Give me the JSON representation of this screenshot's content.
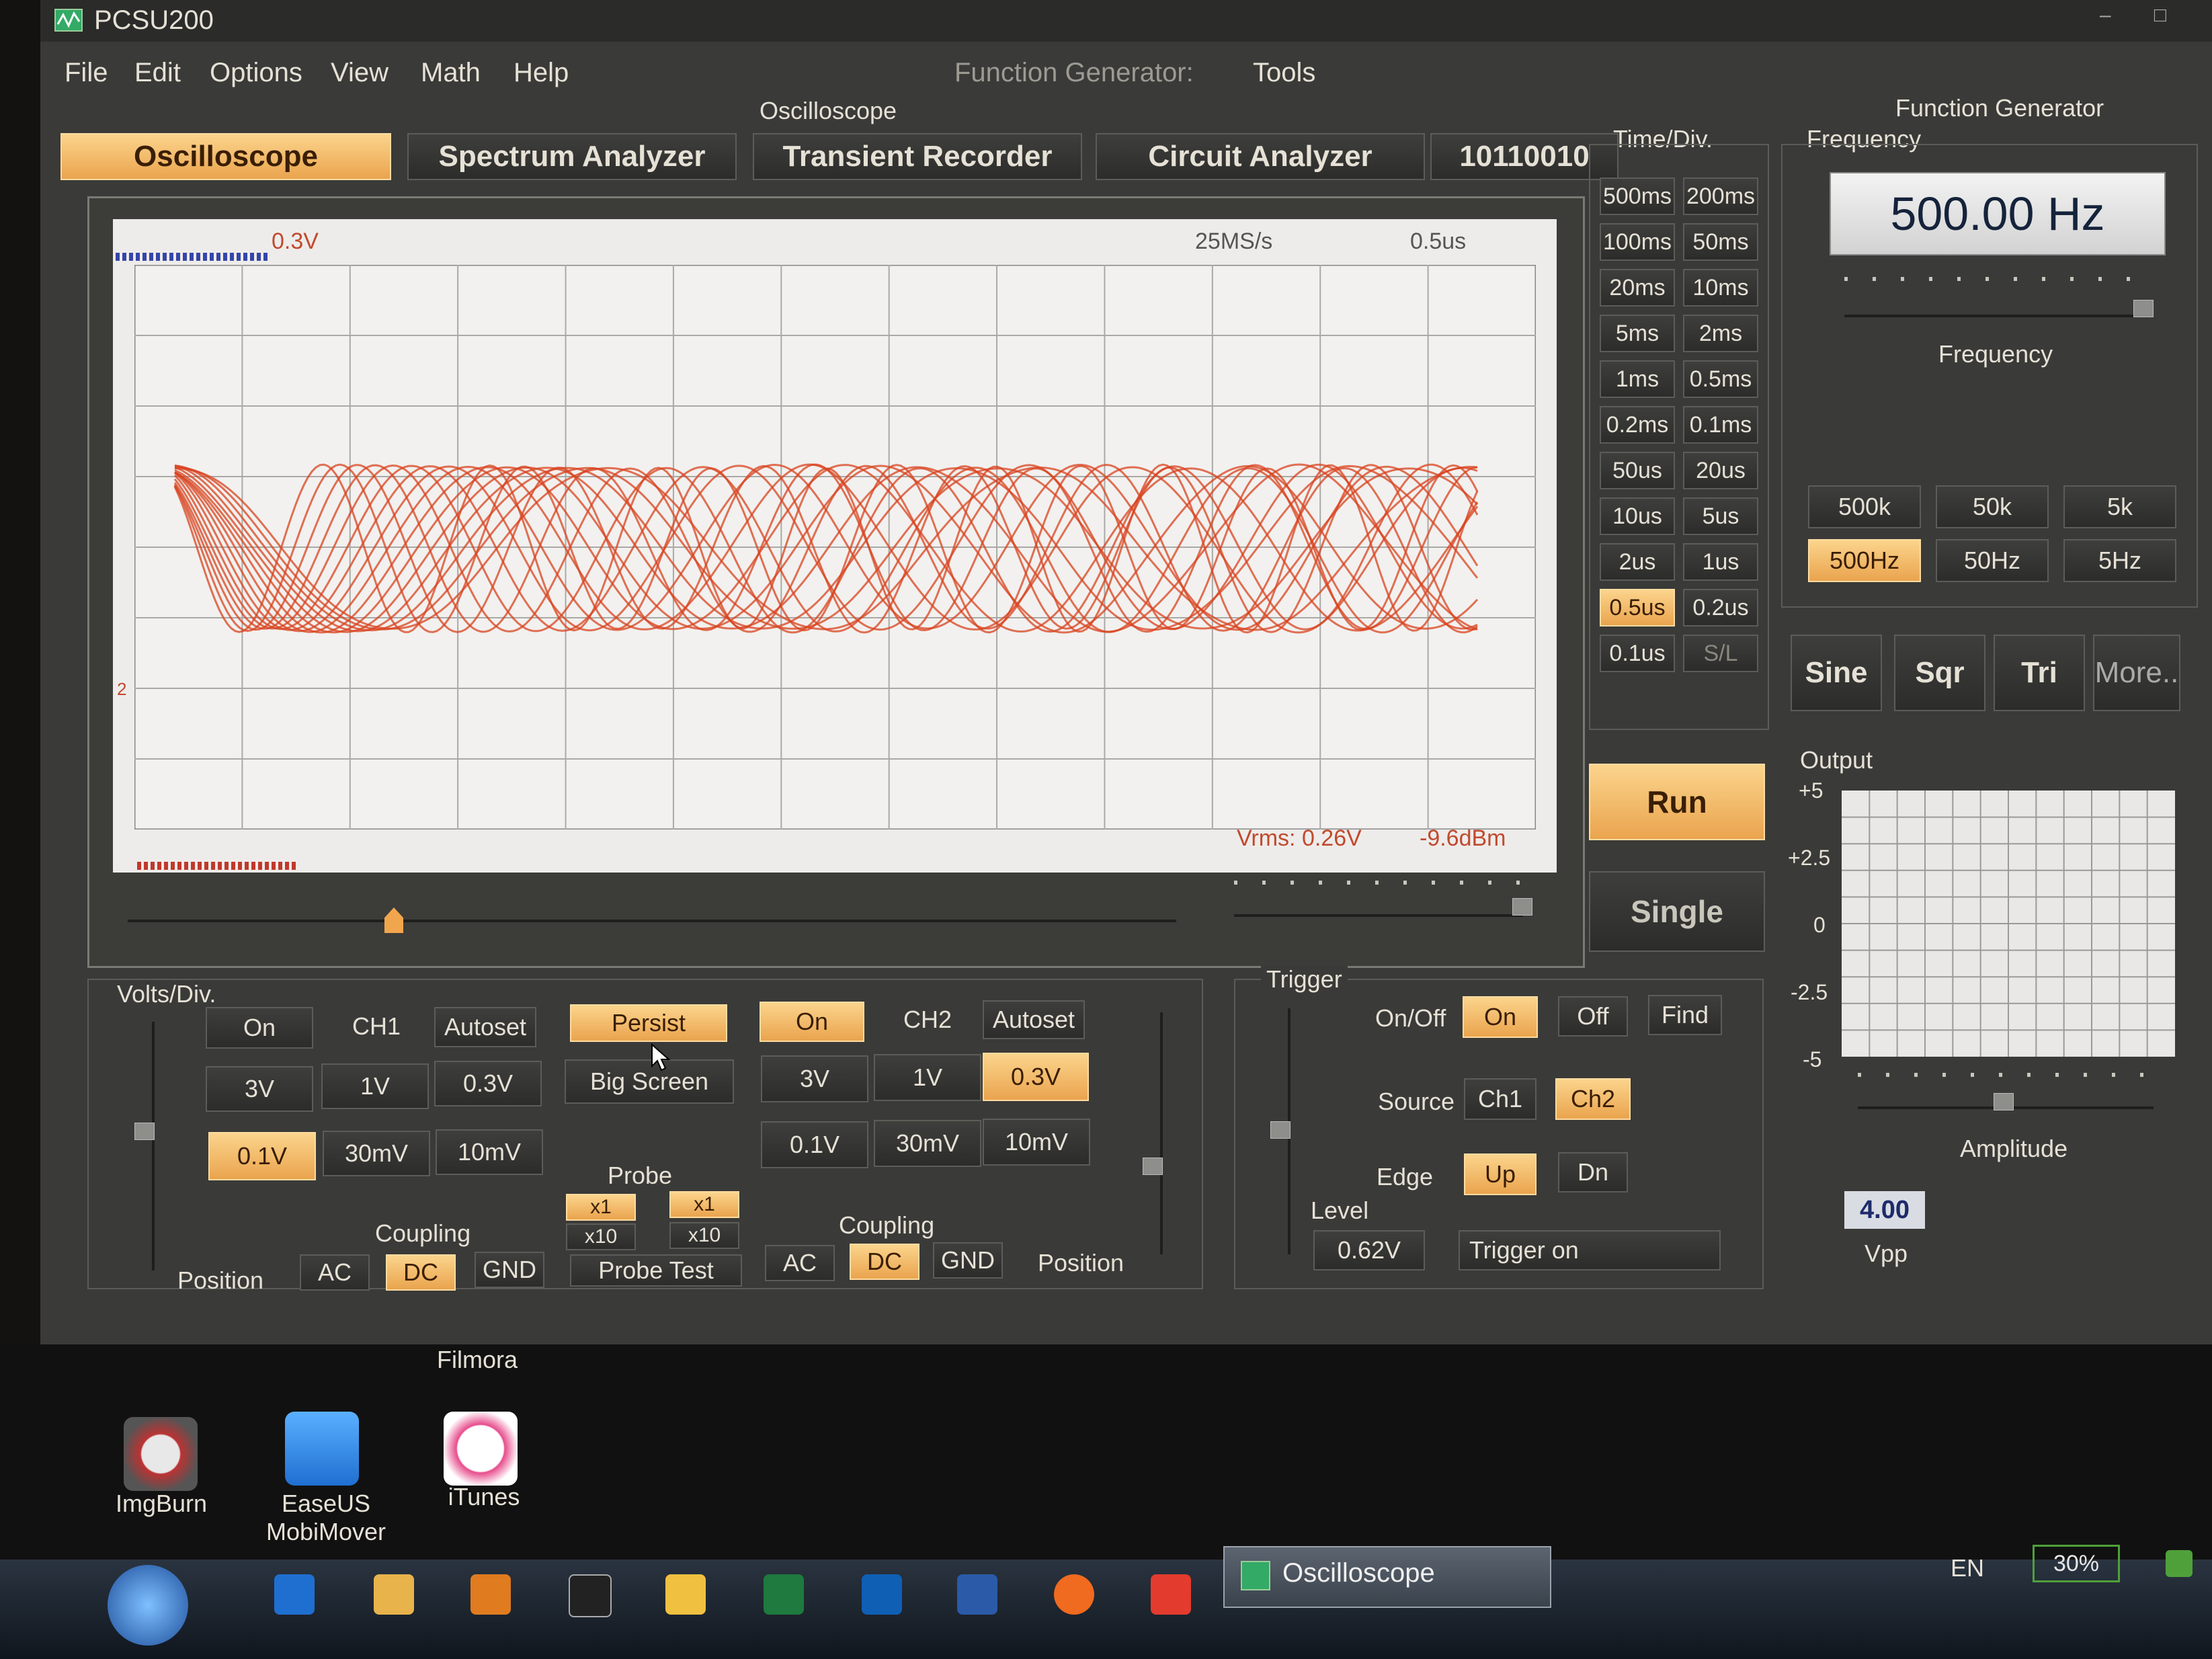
{
  "window": {
    "title": "PCSU200",
    "controls": "– □"
  },
  "menu": {
    "items": [
      "File",
      "Edit",
      "Options",
      "View",
      "Math",
      "Help"
    ],
    "function_generator": "Function Generator:",
    "tools": "Tools"
  },
  "tabs": {
    "group_label": "Oscilloscope",
    "items": [
      "Oscilloscope",
      "Spectrum Analyzer",
      "Transient Recorder",
      "Circuit Analyzer"
    ],
    "active": "Oscilloscope",
    "logic_code": "10110010"
  },
  "screen": {
    "ch_volts": "0.3V",
    "sample_rate": "25MS/s",
    "time_per_div": "0.5us",
    "marker_2": "2",
    "vrms": "Vrms: 0.26V",
    "dbm": "-9.6dBm",
    "trace_color": "#d8431f"
  },
  "timebase": {
    "label": "Time/Div.",
    "buttons": [
      "500ms",
      "200ms",
      "100ms",
      "50ms",
      "20ms",
      "10ms",
      "5ms",
      "2ms",
      "1ms",
      "0.5ms",
      "0.2ms",
      "0.1ms",
      "50us",
      "20us",
      "10us",
      "5us",
      "2us",
      "1us",
      "0.5us",
      "0.2us",
      "0.1us",
      "S/L"
    ],
    "active": "0.5us"
  },
  "run": {
    "run": "Run",
    "single": "Single"
  },
  "function_generator": {
    "label": "Function Generator",
    "frequency_label": "Frequency",
    "frequency_value": "500.00 Hz",
    "slider_label": "Frequency",
    "ranges": [
      "500k",
      "50k",
      "5k",
      "500Hz",
      "50Hz",
      "5Hz"
    ],
    "active_range": "500Hz",
    "waves": [
      "Sine",
      "Sqr",
      "Tri",
      "More.."
    ],
    "output_label": "Output",
    "output_ticks": [
      "+5",
      "+2.5",
      "0",
      "-2.5",
      "-5"
    ],
    "amplitude_label": "Amplitude",
    "amplitude_value": "4.00",
    "amplitude_unit": "Vpp"
  },
  "ch1": {
    "volts_label": "Volts/Div.",
    "on": "On",
    "name": "CH1",
    "autoset": "Autoset",
    "volts": [
      "3V",
      "1V",
      "0.3V",
      "0.1V",
      "30mV",
      "10mV"
    ],
    "active_volts": "0.1V",
    "coupling_label": "Coupling",
    "coupling": [
      "AC",
      "DC",
      "GND"
    ],
    "active_coupling": "DC",
    "position_label": "Position"
  },
  "center": {
    "persist": "Persist",
    "big_screen": "Big Screen",
    "probe_label": "Probe",
    "probe_x1": "x1",
    "probe_x10": "x10",
    "probe_test": "Probe Test"
  },
  "ch2": {
    "on": "On",
    "name": "CH2",
    "autoset": "Autoset",
    "volts": [
      "3V",
      "1V",
      "0.3V",
      "0.1V",
      "30mV",
      "10mV"
    ],
    "active_volts": "0.3V",
    "coupling_label": "Coupling",
    "coupling": [
      "AC",
      "DC",
      "GND"
    ],
    "active_coupling": "DC",
    "position_label": "Position"
  },
  "trigger": {
    "label": "Trigger",
    "onoff_label": "On/Off",
    "on": "On",
    "off": "Off",
    "find": "Find",
    "source_label": "Source",
    "ch1": "Ch1",
    "ch2": "Ch2",
    "edge_label": "Edge",
    "up": "Up",
    "dn": "Dn",
    "level_label": "Level",
    "level_value": "0.62V",
    "trigger_on": "Trigger on"
  },
  "desktop": {
    "filmora": "Filmora",
    "icons": [
      "ImgBurn",
      "EaseUS\nMobiMover",
      "iTunes"
    ]
  },
  "taskbar": {
    "active_window": "Oscilloscope",
    "lang": "EN",
    "battery": "30%"
  }
}
